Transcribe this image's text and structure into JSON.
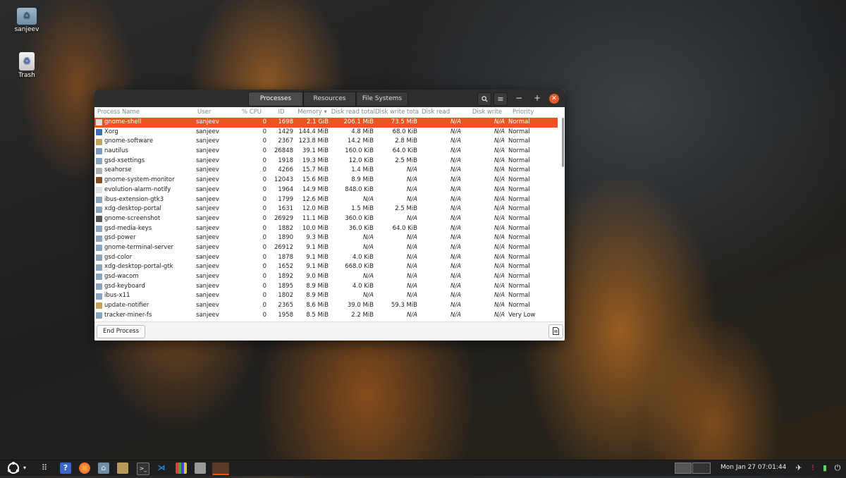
{
  "desktop": {
    "icons": [
      {
        "label": "sanjeev",
        "icon": "home-folder-icon"
      },
      {
        "label": "Trash",
        "icon": "trash-icon"
      }
    ]
  },
  "window": {
    "tabs": [
      "Processes",
      "Resources",
      "File Systems"
    ],
    "active_tab": "Processes",
    "buttons": {
      "search": "search-icon",
      "menu": "hamburger-menu-icon",
      "minimize": "−",
      "maximize": "+",
      "close": "✕"
    },
    "columns": [
      "Process Name",
      "User",
      "% CPU",
      "ID",
      "Memory",
      "Disk read total",
      "Disk write tota",
      "Disk read",
      "Disk write",
      "Priority"
    ],
    "sort_indicator": "▾",
    "rows": [
      {
        "name": "gnome-shell",
        "user": "sanjeev",
        "cpu": "0",
        "id": "1698",
        "mem": "2.1 GiB",
        "dr": "206.1 MiB",
        "dw": "73.5 MiB",
        "drd": "N/A",
        "dwr": "N/A",
        "pri": "Normal",
        "color": "#dddddd"
      },
      {
        "name": "Xorg",
        "user": "sanjeev",
        "cpu": "0",
        "id": "1429",
        "mem": "144.4 MiB",
        "dr": "4.8 MiB",
        "dw": "68.0 KiB",
        "drd": "N/A",
        "dwr": "N/A",
        "pri": "Normal",
        "color": "#3b6fb6"
      },
      {
        "name": "gnome-software",
        "user": "sanjeev",
        "cpu": "0",
        "id": "2367",
        "mem": "123.8 MiB",
        "dr": "14.2 MiB",
        "dw": "2.8 MiB",
        "drd": "N/A",
        "dwr": "N/A",
        "pri": "Normal",
        "color": "#c8a15a"
      },
      {
        "name": "nautilus",
        "user": "sanjeev",
        "cpu": "0",
        "id": "26848",
        "mem": "39.1 MiB",
        "dr": "160.0 KiB",
        "dw": "64.0 KiB",
        "drd": "N/A",
        "dwr": "N/A",
        "pri": "Normal",
        "color": "#7a9bbf"
      },
      {
        "name": "gsd-xsettings",
        "user": "sanjeev",
        "cpu": "0",
        "id": "1918",
        "mem": "19.3 MiB",
        "dr": "12.0 KiB",
        "dw": "2.5 MiB",
        "drd": "N/A",
        "dwr": "N/A",
        "pri": "Normal",
        "color": "#8aa4c0"
      },
      {
        "name": "seahorse",
        "user": "sanjeev",
        "cpu": "0",
        "id": "4266",
        "mem": "15.7 MiB",
        "dr": "1.4 MiB",
        "dw": "N/A",
        "drd": "N/A",
        "dwr": "N/A",
        "pri": "Normal",
        "color": "#b0b0b0"
      },
      {
        "name": "gnome-system-monitor",
        "user": "sanjeev",
        "cpu": "0",
        "id": "12043",
        "mem": "15.6 MiB",
        "dr": "8.9 MiB",
        "dw": "N/A",
        "drd": "N/A",
        "dwr": "N/A",
        "pri": "Normal",
        "color": "#8a4b22"
      },
      {
        "name": "evolution-alarm-notify",
        "user": "sanjeev",
        "cpu": "0",
        "id": "1964",
        "mem": "14.9 MiB",
        "dr": "848.0 KiB",
        "dw": "N/A",
        "drd": "N/A",
        "dwr": "N/A",
        "pri": "Normal",
        "color": "#e0e0e0"
      },
      {
        "name": "ibus-extension-gtk3",
        "user": "sanjeev",
        "cpu": "0",
        "id": "1799",
        "mem": "12.6 MiB",
        "dr": "N/A",
        "dw": "N/A",
        "drd": "N/A",
        "dwr": "N/A",
        "pri": "Normal",
        "color": "#8aa4c0"
      },
      {
        "name": "xdg-desktop-portal",
        "user": "sanjeev",
        "cpu": "0",
        "id": "1631",
        "mem": "12.0 MiB",
        "dr": "1.5 MiB",
        "dw": "2.5 MiB",
        "drd": "N/A",
        "dwr": "N/A",
        "pri": "Normal",
        "color": "#8aa4c0"
      },
      {
        "name": "gnome-screenshot",
        "user": "sanjeev",
        "cpu": "0",
        "id": "26929",
        "mem": "11.1 MiB",
        "dr": "360.0 KiB",
        "dw": "N/A",
        "drd": "N/A",
        "dwr": "N/A",
        "pri": "Normal",
        "color": "#555555"
      },
      {
        "name": "gsd-media-keys",
        "user": "sanjeev",
        "cpu": "0",
        "id": "1882",
        "mem": "10.0 MiB",
        "dr": "36.0 KiB",
        "dw": "64.0 KiB",
        "drd": "N/A",
        "dwr": "N/A",
        "pri": "Normal",
        "color": "#8aa4c0"
      },
      {
        "name": "gsd-power",
        "user": "sanjeev",
        "cpu": "0",
        "id": "1890",
        "mem": "9.3 MiB",
        "dr": "N/A",
        "dw": "N/A",
        "drd": "N/A",
        "dwr": "N/A",
        "pri": "Normal",
        "color": "#8aa4c0"
      },
      {
        "name": "gnome-terminal-server",
        "user": "sanjeev",
        "cpu": "0",
        "id": "26912",
        "mem": "9.1 MiB",
        "dr": "N/A",
        "dw": "N/A",
        "drd": "N/A",
        "dwr": "N/A",
        "pri": "Normal",
        "color": "#8aa4c0"
      },
      {
        "name": "gsd-color",
        "user": "sanjeev",
        "cpu": "0",
        "id": "1878",
        "mem": "9.1 MiB",
        "dr": "4.0 KiB",
        "dw": "N/A",
        "drd": "N/A",
        "dwr": "N/A",
        "pri": "Normal",
        "color": "#8aa4c0"
      },
      {
        "name": "xdg-desktop-portal-gtk",
        "user": "sanjeev",
        "cpu": "0",
        "id": "1652",
        "mem": "9.1 MiB",
        "dr": "668.0 KiB",
        "dw": "N/A",
        "drd": "N/A",
        "dwr": "N/A",
        "pri": "Normal",
        "color": "#8aa4c0"
      },
      {
        "name": "gsd-wacom",
        "user": "sanjeev",
        "cpu": "0",
        "id": "1892",
        "mem": "9.0 MiB",
        "dr": "N/A",
        "dw": "N/A",
        "drd": "N/A",
        "dwr": "N/A",
        "pri": "Normal",
        "color": "#8aa4c0"
      },
      {
        "name": "gsd-keyboard",
        "user": "sanjeev",
        "cpu": "0",
        "id": "1895",
        "mem": "8.9 MiB",
        "dr": "4.0 KiB",
        "dw": "N/A",
        "drd": "N/A",
        "dwr": "N/A",
        "pri": "Normal",
        "color": "#8aa4c0"
      },
      {
        "name": "ibus-x11",
        "user": "sanjeev",
        "cpu": "0",
        "id": "1802",
        "mem": "8.9 MiB",
        "dr": "N/A",
        "dw": "N/A",
        "drd": "N/A",
        "dwr": "N/A",
        "pri": "Normal",
        "color": "#8aa4c0"
      },
      {
        "name": "update-notifier",
        "user": "sanjeev",
        "cpu": "0",
        "id": "2365",
        "mem": "8.6 MiB",
        "dr": "39.0 MiB",
        "dw": "59.3 MiB",
        "drd": "N/A",
        "dwr": "N/A",
        "pri": "Normal",
        "color": "#c8a15a"
      },
      {
        "name": "tracker-miner-fs",
        "user": "sanjeev",
        "cpu": "0",
        "id": "1958",
        "mem": "8.5 MiB",
        "dr": "2.2 MiB",
        "dw": "N/A",
        "drd": "N/A",
        "dwr": "N/A",
        "pri": "Very Low",
        "color": "#8aa4c0"
      }
    ],
    "selected_row": 0,
    "footer": {
      "end_process_label": "End Process",
      "properties_icon": "properties-icon"
    }
  },
  "taskbar": {
    "menu_icon": "ubuntu-logo-icon",
    "apps": [
      "app-grid-icon",
      "help-icon",
      "firefox-icon",
      "files-icon",
      "archive-icon",
      "terminal-icon",
      "vscode-icon",
      "books-icon",
      "screenshot-app-icon",
      "system-monitor-icon"
    ],
    "clock": "Mon Jan 27  07:01:44",
    "tray": [
      "network-icon",
      "update-icon",
      "battery-icon",
      "power-icon"
    ]
  },
  "colors": {
    "accent": "#e95420",
    "close": "#e85a2c"
  }
}
